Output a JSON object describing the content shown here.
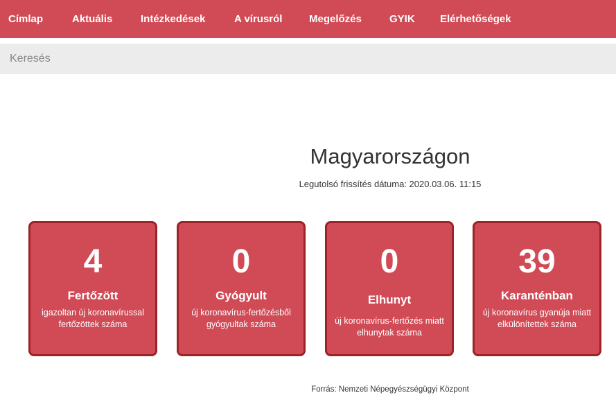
{
  "nav": {
    "items": [
      {
        "label": "Címlap"
      },
      {
        "label": "Aktuális"
      },
      {
        "label": "Intézkedések"
      },
      {
        "label": "A vírusról"
      },
      {
        "label": "Megelőzés"
      },
      {
        "label": "GYIK"
      },
      {
        "label": "Elérhetőségek"
      }
    ]
  },
  "search": {
    "placeholder": "Keresés",
    "value": ""
  },
  "main": {
    "headline": "Magyarországon",
    "updated": "Legutolsó frissítés dátuma: 2020.03.06. 11:15",
    "stats": [
      {
        "value": "4",
        "title": "Fertőzött",
        "desc": "igazoltan új koronavírussal fertőzöttek száma"
      },
      {
        "value": "0",
        "title": "Gyógyult",
        "desc": "új koronavírus-fertőzésből gyógyultak száma"
      },
      {
        "value": "0",
        "title": "Elhunyt",
        "desc": "új koronavírus-fertőzés miatt elhunytak száma"
      },
      {
        "value": "39",
        "title": "Karanténban",
        "desc": "új koronavírus gyanúja miatt elkülönítettek száma"
      }
    ],
    "source": "Forrás: Nemzeti Népegyészségügyi Központ"
  },
  "colors": {
    "accent": "#d14b56",
    "card_border": "#9c2327",
    "search_bg": "#ececec"
  }
}
